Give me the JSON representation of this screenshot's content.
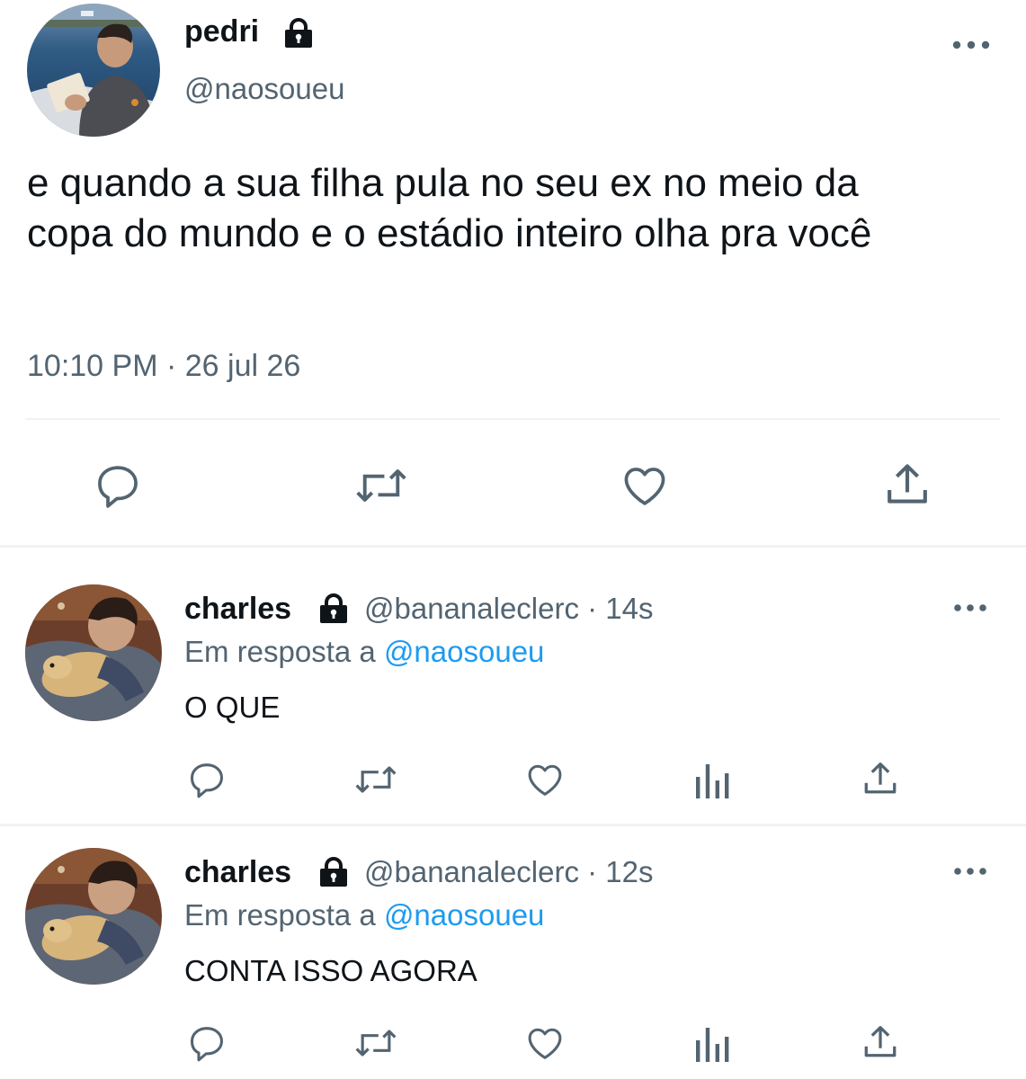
{
  "main_tweet": {
    "avatar_icon": "avatar-photo-reading-on-boat",
    "display_name": "pedri",
    "protected_icon": "lock-icon",
    "handle": "@naosoueu",
    "more_icon": "more-icon",
    "text_line_1": "e quando a sua filha pula no seu ex no meio da",
    "text_line_2": "copa do mundo e o estádio inteiro olha pra você",
    "timestamp": "10:10 PM · 26 jul 26",
    "actions": [
      "reply-icon",
      "retweet-icon",
      "like-icon",
      "share-icon"
    ]
  },
  "replies": [
    {
      "avatar_icon": "avatar-photo-with-dog",
      "display_name": "charles",
      "protected_icon": "lock-icon",
      "meta": "@bananaleclerc · 14s",
      "replying_prefix": "Em resposta a",
      "replying_mention": "@naosoueu",
      "text": "O QUE",
      "actions": [
        "reply-icon",
        "retweet-icon",
        "like-icon",
        "analytics-icon",
        "share-icon"
      ]
    },
    {
      "avatar_icon": "avatar-photo-with-dog",
      "display_name": "charles",
      "protected_icon": "lock-icon",
      "meta": "@bananaleclerc · 12s",
      "replying_prefix": "Em resposta a",
      "replying_mention": "@naosoueu",
      "text": "CONTA ISSO AGORA",
      "actions": [
        "reply-icon",
        "retweet-icon",
        "like-icon",
        "analytics-icon",
        "share-icon"
      ]
    }
  ],
  "colors": {
    "text": "#0f1419",
    "secondary": "#536471",
    "mention": "#1d9bf0",
    "divider": "#eff3f4"
  }
}
